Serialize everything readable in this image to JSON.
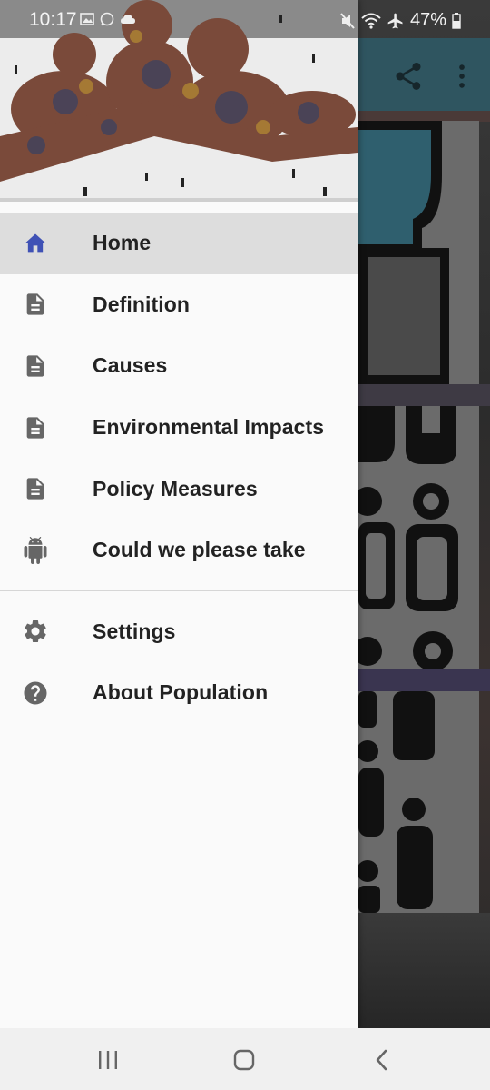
{
  "status_bar": {
    "time": "10:17",
    "battery": "47%"
  },
  "drawer": {
    "header_image": "crowd-of-people-forming-family-shape",
    "items": [
      {
        "label": "Home",
        "icon": "home-icon",
        "active": true
      },
      {
        "label": "Definition",
        "icon": "document-icon",
        "active": false
      },
      {
        "label": "Causes",
        "icon": "document-icon",
        "active": false
      },
      {
        "label": "Environmental Impacts",
        "icon": "document-icon",
        "active": false
      },
      {
        "label": "Policy Measures",
        "icon": "document-icon",
        "active": false
      },
      {
        "label": "Could we please take",
        "icon": "android-icon",
        "active": false
      }
    ],
    "secondary_items": [
      {
        "label": "Settings",
        "icon": "gear-icon"
      },
      {
        "label": "About Population",
        "icon": "help-icon"
      }
    ]
  },
  "app_toolbar": {
    "actions": [
      "share-icon",
      "more-vert-icon"
    ]
  },
  "colors": {
    "accent": "#3f51b5",
    "icon_gray": "#666666",
    "active_row": "#dddddd",
    "drawer_bg": "#fafafa",
    "toolbar_bg": "#2f5560"
  }
}
